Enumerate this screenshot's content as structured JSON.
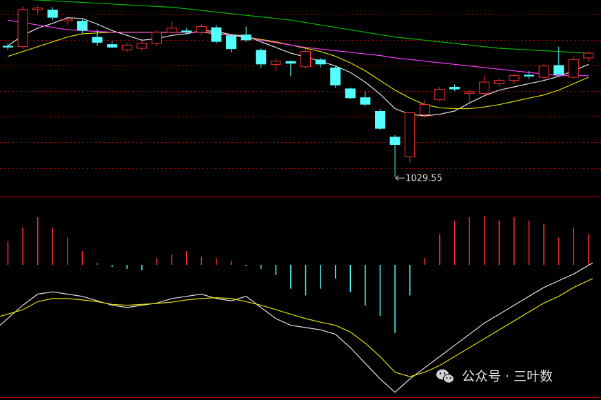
{
  "watermark": {
    "text": "公众号 · 三叶数",
    "icon": "wechat-icon"
  },
  "colors": {
    "background": "#000000",
    "up": "#ff3232",
    "down": "#54ffff",
    "grid": "#c00000",
    "ma5": "#e6e6e6",
    "ma10": "#e0e000",
    "ma20": "#ff40ff",
    "ma60": "#00c000",
    "dif": "#e6e6e6",
    "dea": "#e0e000"
  },
  "chart_data": [
    {
      "type": "candlestick",
      "title": "",
      "price_range": [
        1010,
        1250
      ],
      "low_label": "1029.55",
      "candles": [
        {
          "o": 1193,
          "h": 1196,
          "l": 1188,
          "c": 1191
        },
        {
          "o": 1192,
          "h": 1242,
          "l": 1189,
          "c": 1238
        },
        {
          "o": 1238,
          "h": 1242,
          "l": 1233,
          "c": 1240
        },
        {
          "o": 1238,
          "h": 1241,
          "l": 1225,
          "c": 1228
        },
        {
          "o": 1224,
          "h": 1227,
          "l": 1218,
          "c": 1226
        },
        {
          "o": 1224,
          "h": 1226,
          "l": 1209,
          "c": 1212
        },
        {
          "o": 1204,
          "h": 1213,
          "l": 1193,
          "c": 1197
        },
        {
          "o": 1195,
          "h": 1199,
          "l": 1190,
          "c": 1191
        },
        {
          "o": 1188,
          "h": 1196,
          "l": 1185,
          "c": 1194
        },
        {
          "o": 1190,
          "h": 1202,
          "l": 1187,
          "c": 1196
        },
        {
          "o": 1196,
          "h": 1212,
          "l": 1193,
          "c": 1210
        },
        {
          "o": 1210,
          "h": 1223,
          "l": 1208,
          "c": 1215
        },
        {
          "o": 1212,
          "h": 1215,
          "l": 1208,
          "c": 1210
        },
        {
          "o": 1210,
          "h": 1220,
          "l": 1207,
          "c": 1217
        },
        {
          "o": 1216,
          "h": 1219,
          "l": 1196,
          "c": 1198
        },
        {
          "o": 1206,
          "h": 1208,
          "l": 1185,
          "c": 1189
        },
        {
          "o": 1207,
          "h": 1217,
          "l": 1198,
          "c": 1200
        },
        {
          "o": 1188,
          "h": 1190,
          "l": 1165,
          "c": 1170
        },
        {
          "o": 1170,
          "h": 1177,
          "l": 1162,
          "c": 1174
        },
        {
          "o": 1174,
          "h": 1175,
          "l": 1155,
          "c": 1171
        },
        {
          "o": 1167,
          "h": 1190,
          "l": 1165,
          "c": 1186
        },
        {
          "o": 1176,
          "h": 1178,
          "l": 1166,
          "c": 1170
        },
        {
          "o": 1166,
          "h": 1168,
          "l": 1141,
          "c": 1144
        },
        {
          "o": 1140,
          "h": 1141,
          "l": 1127,
          "c": 1128
        },
        {
          "o": 1129,
          "h": 1136,
          "l": 1118,
          "c": 1120
        },
        {
          "o": 1112,
          "h": 1115,
          "l": 1088,
          "c": 1090
        },
        {
          "o": 1080,
          "h": 1082,
          "l": 1030,
          "c": 1070
        },
        {
          "o": 1055,
          "h": 1111,
          "l": 1048,
          "c": 1110
        },
        {
          "o": 1108,
          "h": 1126,
          "l": 1104,
          "c": 1120
        },
        {
          "o": 1126,
          "h": 1142,
          "l": 1124,
          "c": 1139
        },
        {
          "o": 1142,
          "h": 1145,
          "l": 1137,
          "c": 1139
        },
        {
          "o": 1134,
          "h": 1138,
          "l": 1122,
          "c": 1136
        },
        {
          "o": 1134,
          "h": 1156,
          "l": 1131,
          "c": 1148
        },
        {
          "o": 1146,
          "h": 1152,
          "l": 1143,
          "c": 1150
        },
        {
          "o": 1150,
          "h": 1158,
          "l": 1146,
          "c": 1156
        },
        {
          "o": 1157,
          "h": 1162,
          "l": 1152,
          "c": 1155
        },
        {
          "o": 1154,
          "h": 1170,
          "l": 1151,
          "c": 1168
        },
        {
          "o": 1169,
          "h": 1192,
          "l": 1162,
          "c": 1157
        },
        {
          "o": 1154,
          "h": 1180,
          "l": 1152,
          "c": 1176
        },
        {
          "o": 1178,
          "h": 1186,
          "l": 1174,
          "c": 1184
        }
      ],
      "ma": [
        {
          "name": "MA5",
          "color": "ma5",
          "values": [
            1193,
            1206,
            1215,
            1221,
            1228,
            1227,
            1220,
            1212,
            1206,
            1200,
            1202,
            1206,
            1208,
            1212,
            1211,
            1207,
            1205,
            1198,
            1191,
            1184,
            1179,
            1174,
            1168,
            1160,
            1148,
            1133,
            1115,
            1108,
            1106,
            1108,
            1112,
            1122,
            1131,
            1138,
            1142,
            1146,
            1150,
            1155,
            1162,
            1170
          ]
        },
        {
          "name": "MA10",
          "color": "ma10",
          "values": [
            1180,
            1186,
            1192,
            1198,
            1204,
            1208,
            1209,
            1210,
            1210,
            1210,
            1210,
            1210,
            1210,
            1210,
            1208,
            1206,
            1204,
            1201,
            1198,
            1194,
            1190,
            1186,
            1180,
            1172,
            1162,
            1150,
            1138,
            1128,
            1120,
            1116,
            1115,
            1115,
            1117,
            1120,
            1124,
            1128,
            1132,
            1138,
            1146,
            1154
          ]
        },
        {
          "name": "MA20",
          "color": "ma20",
          "values": [
            1225,
            1222,
            1219,
            1216,
            1213,
            1212,
            1211,
            1210,
            1210,
            1210,
            1210,
            1210,
            1210,
            1210,
            1209,
            1206,
            1203,
            1200,
            1197,
            1194,
            1191,
            1189,
            1187,
            1185,
            1183,
            1181,
            1178,
            1176,
            1174,
            1172,
            1170,
            1168,
            1166,
            1164,
            1162,
            1160,
            1158,
            1156,
            1156,
            1156
          ]
        },
        {
          "name": "MA60",
          "color": "ma60",
          "values": [
            1252,
            1251,
            1250,
            1249,
            1248,
            1247,
            1246,
            1245,
            1244,
            1243,
            1242,
            1241,
            1239,
            1237,
            1235,
            1233,
            1231,
            1229,
            1227,
            1225,
            1222,
            1219,
            1216,
            1213,
            1210,
            1207,
            1204,
            1202,
            1200,
            1198,
            1196,
            1194,
            1192,
            1190,
            1189,
            1188,
            1187,
            1186,
            1185,
            1184
          ]
        }
      ]
    },
    {
      "type": "macd",
      "title": "",
      "value_range": [
        -1.15,
        0.8
      ],
      "histogram": [
        0.35,
        0.55,
        0.7,
        0.55,
        0.4,
        0.2,
        0.03,
        -0.03,
        -0.06,
        -0.08,
        0.1,
        0.15,
        0.2,
        0.12,
        0.1,
        0.06,
        -0.02,
        -0.06,
        -0.15,
        -0.35,
        -0.45,
        -0.35,
        -0.2,
        -0.4,
        -0.6,
        -0.75,
        -1.0,
        -0.45,
        0.1,
        0.45,
        0.65,
        0.7,
        0.72,
        0.65,
        0.7,
        0.65,
        0.6,
        0.4,
        0.55,
        0.45
      ],
      "dif": [
        -0.95,
        -0.5,
        -0.25,
        -0.2,
        -0.25,
        -0.3,
        -0.4,
        -0.5,
        -0.55,
        -0.5,
        -0.45,
        -0.35,
        -0.3,
        -0.25,
        -0.35,
        -0.4,
        -0.3,
        -0.55,
        -0.8,
        -0.95,
        -1.0,
        -1.05,
        -1.15,
        -1.45,
        -1.8,
        -2.15,
        -2.45,
        -2.15,
        -1.9,
        -1.65,
        -1.4,
        -1.15,
        -0.9,
        -0.7,
        -0.5,
        -0.3,
        -0.1,
        0.05,
        0.2,
        0.45
      ],
      "dea": [
        -0.75,
        -0.6,
        -0.42,
        -0.35,
        -0.35,
        -0.38,
        -0.42,
        -0.48,
        -0.5,
        -0.48,
        -0.46,
        -0.43,
        -0.38,
        -0.35,
        -0.33,
        -0.35,
        -0.42,
        -0.5,
        -0.6,
        -0.7,
        -0.8,
        -0.88,
        -0.95,
        -1.1,
        -1.35,
        -1.65,
        -2.0,
        -2.1,
        -2.0,
        -1.85,
        -1.65,
        -1.45,
        -1.25,
        -1.05,
        -0.85,
        -0.65,
        -0.45,
        -0.3,
        -0.1,
        0.1
      ],
      "line_range": [
        -2.5,
        0.7
      ]
    }
  ]
}
